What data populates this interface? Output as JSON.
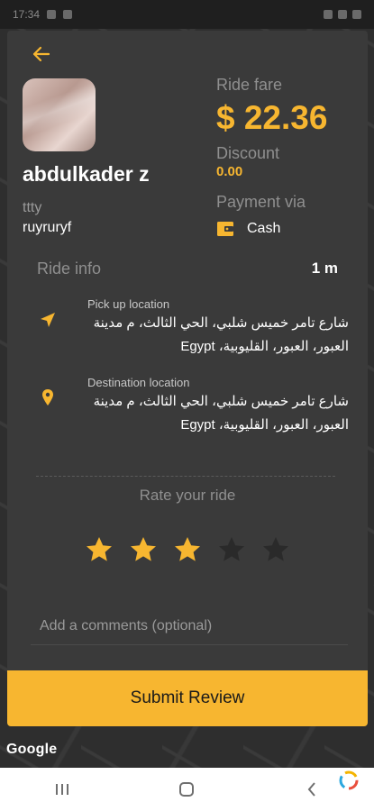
{
  "status_bar": {
    "time": "17:34"
  },
  "header": {
    "back_icon": "arrow-left-icon"
  },
  "driver": {
    "name": "abdulkader z",
    "subtitle": "ttty",
    "detail": "ruyruryf"
  },
  "fare": {
    "label": "Ride fare",
    "value": "$ 22.36",
    "discount_label": "Discount",
    "discount_value": "0.00",
    "payment_label": "Payment via",
    "payment_method": "Cash",
    "payment_icon": "wallet-icon"
  },
  "ride_info": {
    "label": "Ride info",
    "duration": "1 m",
    "pickup": {
      "label": "Pick up location",
      "address": "شارع تامر خميس شلبي، الحي الثالث، م مدينة العبور، العبور، القليوبية، Egypt",
      "icon": "navigation-arrow-icon"
    },
    "destination": {
      "label": "Destination location",
      "address": "شارع تامر خميس شلبي، الحي الثالث، م مدينة العبور، العبور، القليوبية، Egypt",
      "icon": "map-pin-icon"
    }
  },
  "rating": {
    "label": "Rate your ride",
    "value": 3,
    "max": 5
  },
  "comment": {
    "placeholder": "Add a comments (optional)",
    "value": ""
  },
  "submit": {
    "label": "Submit Review"
  },
  "map": {
    "attribution": "Google"
  },
  "colors": {
    "accent": "#f7b630",
    "card": "#3a3a3a",
    "text": "#ffffff",
    "muted": "#8f8f8f"
  }
}
